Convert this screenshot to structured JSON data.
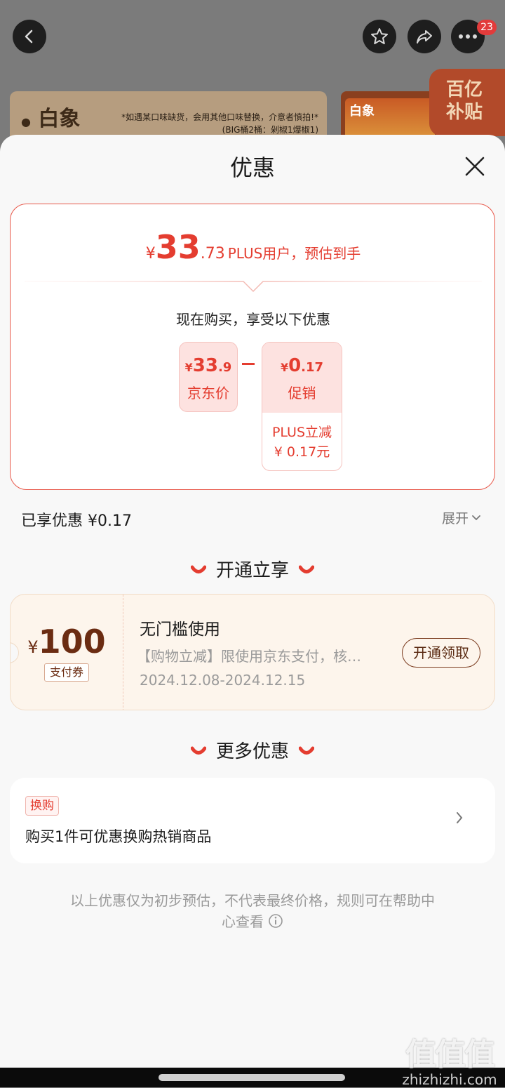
{
  "background": {
    "badge_count": "23",
    "banner_brand": "白象",
    "banner_note_line1": "*如遇某口味缺货，会用其他口味替换，介意者慎拍!*",
    "banner_note_line2": "(BIG桶2桶：剁椒1爆椒1)",
    "product_label": "白象",
    "subsidy_line1": "百亿",
    "subsidy_line2": "补贴"
  },
  "sheet": {
    "title": "优惠",
    "estimate": {
      "yen": "¥",
      "integer": "33",
      "decimal": ".73",
      "label": "PLUS用户，预估到手"
    },
    "now_buy_text": "现在购买，享受以下优惠",
    "jd_price": {
      "yen": "¥",
      "integer": "33",
      "decimal": ".9",
      "caption": "京东价"
    },
    "promo": {
      "yen": "¥",
      "integer": "0",
      "decimal": ".17",
      "caption": "促销",
      "detail_line1": "PLUS立减",
      "detail_line2": "¥ 0.17元"
    },
    "enjoyed_text": "已享优惠 ¥0.17",
    "expand_label": "展开",
    "open_section_title": "开通立享",
    "coupon": {
      "yen": "¥",
      "amount": "100",
      "tag": "支付券",
      "title": "无门槛使用",
      "desc": "【购物立减】限使用京东支付，核…",
      "date_range": "2024.12.08-2024.12.15",
      "button_label": "开通领取"
    },
    "more_section_title": "更多优惠",
    "more_offer": {
      "tag": "换购",
      "text": "购买1件可优惠换购热销商品"
    },
    "footnote_line1": "以上优惠仅为初步预估，不代表最终价格，规则可在帮助中",
    "footnote_line2": "心查看"
  },
  "watermark": {
    "glyphs": "值值值",
    "domain": "zhizhizhi.com"
  },
  "colors": {
    "accent": "#e43d30",
    "coupon_brown": "#6b2c12",
    "coupon_bg": "#fdf5ec"
  }
}
